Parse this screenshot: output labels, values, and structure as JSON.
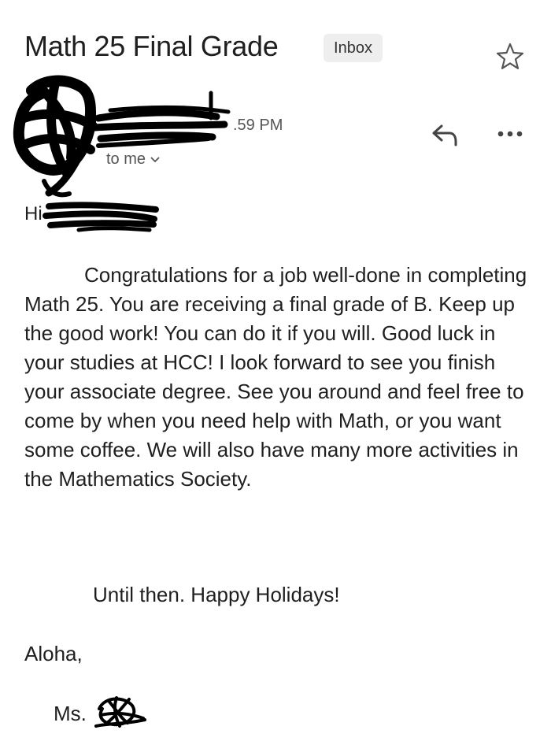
{
  "header": {
    "subject": "Math 25 Final Grade",
    "label": "Inbox",
    "star_icon": "star-outline-icon"
  },
  "sender": {
    "time": ".59 PM",
    "recipient": "to me",
    "reply_icon": "reply-icon",
    "more_icon": "more-horizontal-icon"
  },
  "message": {
    "greeting": "Hi",
    "body": "Congratulations for a job well-done in completing Math 25.  You are receiving a final grade of B.  Keep up the good work!  You can do it if you will.  Good luck in your studies at HCC!  I look forward to see you finish your associate degree.  See you around and feel free to come by when you need help with Math, or you want some coffee. We will also have many more activities in the Mathematics Society.",
    "closing": "Until then.  Happy Holidays!",
    "signoff": "Aloha,",
    "signature_prefix": "Ms."
  },
  "colors": {
    "text": "#1f1f1f",
    "secondary": "#555555",
    "chip_bg": "#eeeeee",
    "redaction": "#000000"
  }
}
